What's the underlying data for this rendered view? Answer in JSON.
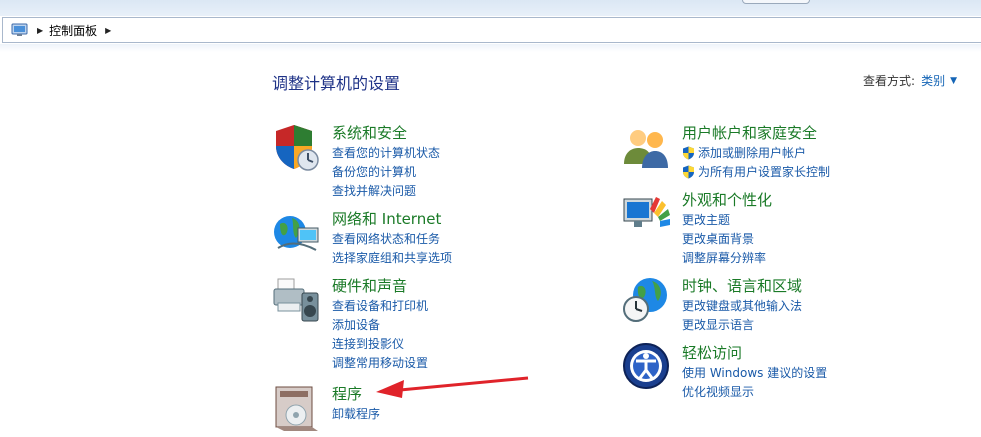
{
  "breadcrumb": {
    "current": "控制面板"
  },
  "header": {
    "title": "调整计算机的设置"
  },
  "view_by": {
    "label": "查看方式:",
    "value": "类别"
  },
  "categories_left": [
    {
      "title": "系统和安全",
      "icon": "security-shield-icon",
      "links": [
        "查看您的计算机状态",
        "备份您的计算机",
        "查找并解决问题"
      ]
    },
    {
      "title": "网络和 Internet",
      "icon": "network-globe-icon",
      "links": [
        "查看网络状态和任务",
        "选择家庭组和共享选项"
      ]
    },
    {
      "title": "硬件和声音",
      "icon": "printer-speaker-icon",
      "links": [
        "查看设备和打印机",
        "添加设备",
        "连接到投影仪",
        "调整常用移动设置"
      ]
    },
    {
      "title": "程序",
      "icon": "programs-box-icon",
      "links": [
        "卸载程序"
      ]
    }
  ],
  "categories_right": [
    {
      "title": "用户帐户和家庭安全",
      "icon": "users-icon",
      "links": [
        "添加或删除用户帐户",
        "为所有用户设置家长控制"
      ]
    },
    {
      "title": "外观和个性化",
      "icon": "monitor-palette-icon",
      "links": [
        "更改主题",
        "更改桌面背景",
        "调整屏幕分辨率"
      ]
    },
    {
      "title": "时钟、语言和区域",
      "icon": "clock-globe-icon",
      "links": [
        "更改键盘或其他输入法",
        "更改显示语言"
      ]
    },
    {
      "title": "轻松访问",
      "icon": "ease-of-access-icon",
      "links": [
        "使用 Windows 建议的设置",
        "优化视频显示"
      ]
    }
  ],
  "colors": {
    "title_blue": "#1e3287",
    "category_green": "#1a7a27",
    "link_blue": "#1a5aa8",
    "arrow_red": "#e0232a"
  }
}
